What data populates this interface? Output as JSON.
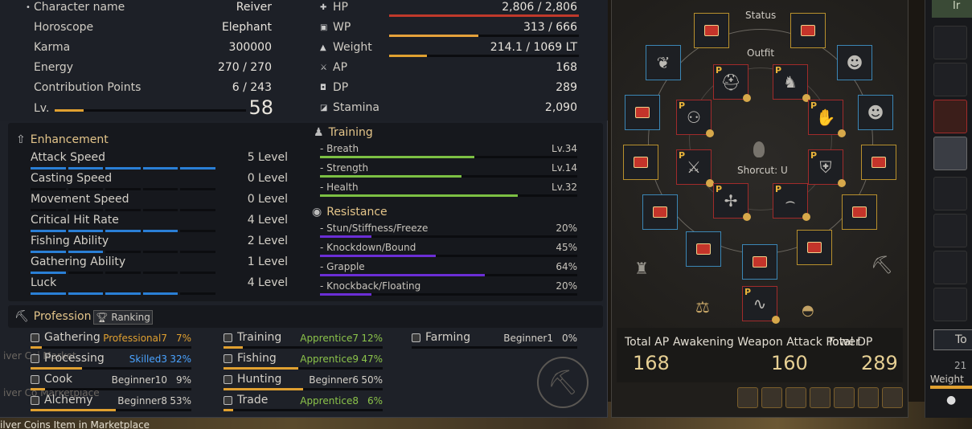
{
  "character": {
    "rows": [
      {
        "label": "Character name",
        "value": "Reiver"
      },
      {
        "label": "Horoscope",
        "value": "Elephant"
      },
      {
        "label": "Karma",
        "value": "300000"
      },
      {
        "label": "Energy",
        "value": "270 / 270"
      },
      {
        "label": "Contribution Points",
        "value": "6 / 243"
      }
    ],
    "level_label": "Lv.",
    "level_value": "58",
    "level_progress": 0.15
  },
  "vitals": [
    {
      "label": "HP",
      "value": "2,806 / 2,806",
      "bar_ratio": 1.0,
      "color": "#c0392b"
    },
    {
      "label": "WP",
      "value": "313 / 666",
      "bar_ratio": 0.47,
      "color": "#e5a13b"
    },
    {
      "label": "Weight",
      "value": "214.1 / 1069 LT",
      "bar_ratio": 0.2,
      "color": "#e0a030"
    },
    {
      "label": "AP",
      "value": "168"
    },
    {
      "label": "DP",
      "value": "289"
    },
    {
      "label": "Stamina",
      "value": "2,090"
    }
  ],
  "enhancement": {
    "title": "Enhancement",
    "items": [
      {
        "label": "Attack Speed",
        "value": "5 Level",
        "level": 5
      },
      {
        "label": "Casting Speed",
        "value": "0 Level",
        "level": 0
      },
      {
        "label": "Movement Speed",
        "value": "0 Level",
        "level": 0
      },
      {
        "label": "Critical Hit Rate",
        "value": "4 Level",
        "level": 4
      },
      {
        "label": "Fishing Ability",
        "value": "2 Level",
        "level": 2
      },
      {
        "label": "Gathering Ability",
        "value": "1 Level",
        "level": 1
      },
      {
        "label": "Luck",
        "value": "4 Level",
        "level": 4
      }
    ]
  },
  "training": {
    "title": "Training",
    "items": [
      {
        "label": "- Breath",
        "value": "Lv.34",
        "ratio": 0.6
      },
      {
        "label": "- Strength",
        "value": "Lv.14",
        "ratio": 0.55
      },
      {
        "label": "- Health",
        "value": "Lv.32",
        "ratio": 0.77
      }
    ]
  },
  "resistance": {
    "title": "Resistance",
    "items": [
      {
        "label": "- Stun/Stiffness/Freeze",
        "value": "20%",
        "ratio": 0.2
      },
      {
        "label": "- Knockdown/Bound",
        "value": "45%",
        "ratio": 0.45
      },
      {
        "label": "- Grapple",
        "value": "64%",
        "ratio": 0.64
      },
      {
        "label": "- Knockback/Floating",
        "value": "20%",
        "ratio": 0.2
      }
    ]
  },
  "profession": {
    "title": "Profession",
    "ranking_label": "Ranking",
    "items": [
      {
        "label": "Gathering",
        "level": "Professional7",
        "pct": "7%",
        "ratio": 0.07,
        "color": "#e0a030"
      },
      {
        "label": "Processing",
        "level": "Skilled3",
        "pct": "32%",
        "ratio": 0.32,
        "color": "#4aa3ff"
      },
      {
        "label": "Cook",
        "level": "Beginner10",
        "pct": "9%",
        "ratio": 0.09,
        "color": "#d4d0c8"
      },
      {
        "label": "Alchemy",
        "level": "Beginner8",
        "pct": "53%",
        "ratio": 0.53,
        "color": "#d4d0c8"
      },
      {
        "label": "Training",
        "level": "Apprentice7",
        "pct": "12%",
        "ratio": 0.12,
        "color": "#8bc34a"
      },
      {
        "label": "Fishing",
        "level": "Apprentice9",
        "pct": "47%",
        "ratio": 0.47,
        "color": "#8bc34a"
      },
      {
        "label": "Hunting",
        "level": "Beginner6",
        "pct": "50%",
        "ratio": 0.5,
        "color": "#d4d0c8"
      },
      {
        "label": "Trade",
        "level": "Apprentice8",
        "pct": "6%",
        "ratio": 0.06,
        "color": "#8bc34a"
      },
      {
        "label": "Farming",
        "level": "Beginner1",
        "pct": "0%",
        "ratio": 0.0,
        "color": "#d4d0c8"
      }
    ]
  },
  "equipment": {
    "status_label": "Status",
    "outfit_label": "Outfit",
    "shortcut_label": "Shorcut: U",
    "totals": [
      {
        "label": "Total AP",
        "value": "168"
      },
      {
        "label": "Awakening Weapon Attack Power",
        "value": "160"
      },
      {
        "label": "Total DP",
        "value": "289"
      }
    ]
  },
  "right_strip": {
    "top_label": "Ir",
    "bottom_label": "Weight",
    "num_label": "21",
    "to_label": "To"
  },
  "background_text": {
    "bottom": "ilver Coins Item in Marketplace",
    "faint1": "iver Coi       Market",
    "faint2": "iver Co        Marketplace"
  }
}
